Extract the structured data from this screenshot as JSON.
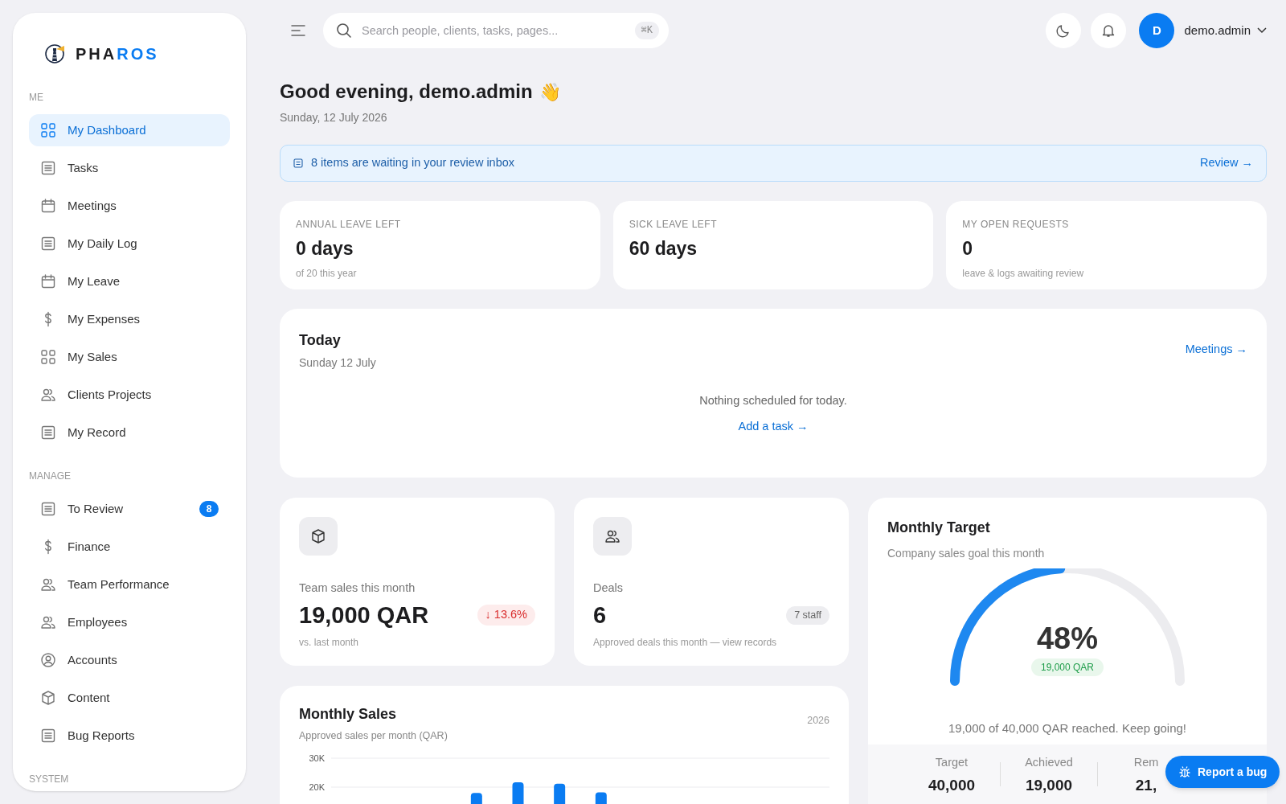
{
  "sidebar": {
    "brand_parts": [
      "PHA",
      "ROS"
    ],
    "sections": [
      {
        "title": "ME",
        "items": [
          {
            "label": "My Dashboard",
            "selected": true
          },
          {
            "label": "Tasks",
            "selected": false
          },
          {
            "label": "Meetings",
            "selected": false
          },
          {
            "label": "My Daily Log",
            "selected": false
          },
          {
            "label": "My Leave",
            "selected": false
          },
          {
            "label": "My Expenses",
            "selected": false
          },
          {
            "label": "My Sales",
            "selected": false
          },
          {
            "label": "Clients Projects",
            "selected": false
          },
          {
            "label": "My Record",
            "selected": false
          }
        ]
      },
      {
        "title": "MANAGE",
        "items": [
          {
            "label": "To Review",
            "selected": false,
            "badge": "8"
          },
          {
            "label": "Finance",
            "selected": false
          },
          {
            "label": "Team Performance",
            "selected": false
          },
          {
            "label": "Employees",
            "selected": false
          },
          {
            "label": "Accounts",
            "selected": false
          },
          {
            "label": "Content",
            "selected": false
          },
          {
            "label": "Bug Reports",
            "selected": false
          }
        ]
      },
      {
        "title": "SYSTEM"
      }
    ]
  },
  "topbar": {
    "search": {
      "placeholder": "Search people, clients, tasks, pages...",
      "shortcut": "⌘K"
    },
    "avatar": "D",
    "user": "demo.admin"
  },
  "greeting": {
    "title": "Good evening, demo.admin",
    "emoji": "👋",
    "date": "Sunday, 12 July 2026"
  },
  "banner": {
    "text": "8 items are waiting in your review inbox",
    "link": "Review →"
  },
  "stats": [
    {
      "label": "ANNUAL LEAVE LEFT",
      "value": "0 days",
      "note": "of 20 this year"
    },
    {
      "label": "SICK LEAVE LEFT",
      "value": "60 days"
    },
    {
      "label": "MY OPEN REQUESTS",
      "value": "0",
      "note": "leave & logs awaiting review"
    }
  ],
  "today": {
    "title": "Today",
    "date": "Sunday 12 July",
    "link": "Meetings →",
    "empty": "Nothing scheduled for today.",
    "action": "Add a task →"
  },
  "kpis": [
    {
      "label": "Team sales this month",
      "value": "19,000 QAR",
      "change": "↓ 13.6%",
      "note": "vs. last month"
    },
    {
      "label": "Deals",
      "value": "6",
      "tag": "7 staff",
      "note": "Approved deals this month — view records"
    }
  ],
  "monthly_sales": {
    "title": "Monthly Sales",
    "subtitle": "Approved sales per month (QAR)",
    "year": "2026",
    "chart_data": {
      "type": "bar",
      "ylim": [
        0,
        30000
      ],
      "yticks": [
        {
          "value": 20000,
          "label": "20K"
        },
        {
          "value": 30000,
          "label": "30K"
        }
      ],
      "series": [
        {
          "color": "#0a7cf2",
          "values": [
            null,
            null,
            null,
            18000,
            21700,
            21200,
            18200,
            null,
            null,
            null,
            null,
            null
          ]
        }
      ]
    }
  },
  "target": {
    "title": "Monthly Target",
    "subtitle": "Company sales goal this month",
    "level": 0.48,
    "percent": "48%",
    "amount": "19,000 QAR",
    "message": "19,000 of 40,000 QAR reached. Keep going!",
    "figures": [
      {
        "label": "Target",
        "value": "40,000"
      },
      {
        "label": "Achieved",
        "value": "19,000"
      },
      {
        "label": "Rem",
        "value": "21,"
      }
    ]
  },
  "report_button": "Report a bug"
}
